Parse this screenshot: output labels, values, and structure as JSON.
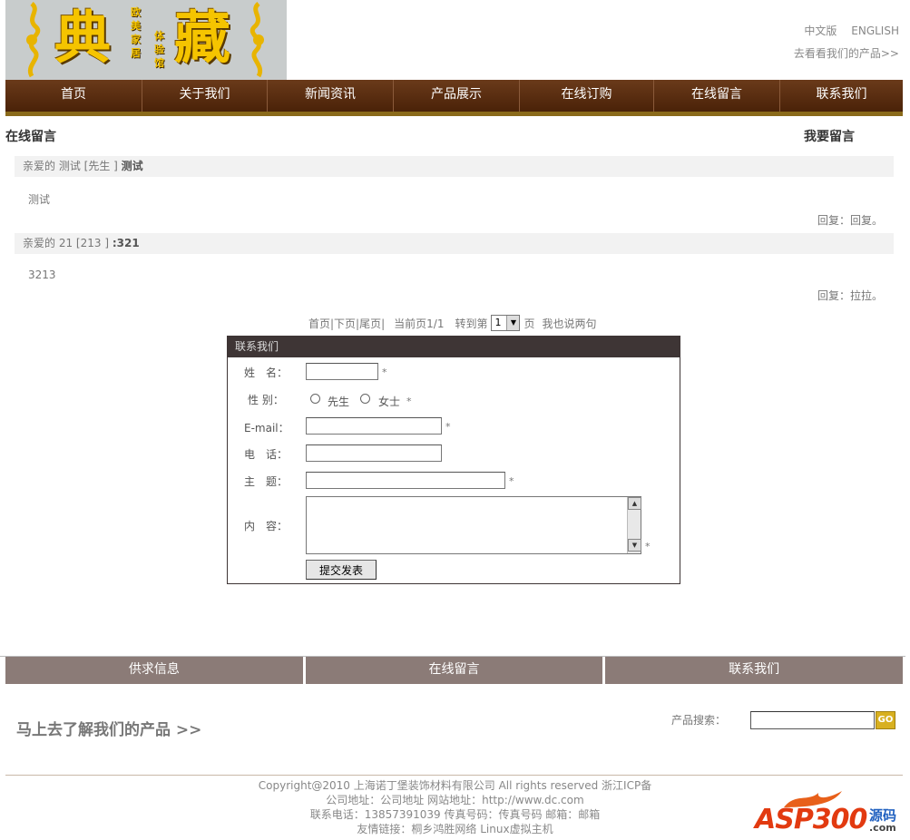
{
  "logo": {
    "char1": "典",
    "char2": "藏",
    "vert1": "欧美家居",
    "vert2": "体验馆"
  },
  "toplinks": {
    "lang_cn": "中文版",
    "lang_en": "ENGLISH",
    "products": "去看看我们的产品>>"
  },
  "nav": {
    "items": [
      "首页",
      "关于我们",
      "新闻资讯",
      "产品展示",
      "在线订购",
      "在线留言",
      "联系我们"
    ]
  },
  "page": {
    "section_title": "在线留言",
    "leave_message": "我要留言"
  },
  "messages": [
    {
      "prefix": "亲爱的",
      "name": "测试 [先生 ]",
      "subject": "测试",
      "body": "测试",
      "reply_label": "回复：",
      "reply": "回复。"
    },
    {
      "prefix": "亲爱的",
      "name": "21 [213 ]",
      "subject": ":321",
      "body": "3213",
      "reply_label": "回复：",
      "reply": "拉拉。"
    }
  ],
  "pager": {
    "links": "首页|下页|尾页|",
    "current": "当前页1/1",
    "goto": "转到第",
    "page_value": "1",
    "page_unit": "页",
    "say": "我也说两句"
  },
  "form": {
    "title": "联系我们",
    "name_label": "姓　名：",
    "gender_label": "性 别：",
    "male": "先生",
    "female": "女士",
    "email_label": "E-mail：",
    "phone_label": "电　话：",
    "subject_label": "主　题：",
    "content_label": "内　容：",
    "required": "*",
    "submit": "提交发表"
  },
  "footnav": {
    "items": [
      "供求信息",
      "在线留言",
      "联系我们"
    ]
  },
  "promo": {
    "text": "马上去了解我们的产品 >>",
    "search_label": "产品搜索：",
    "go": "GO"
  },
  "footer": {
    "line1": "Copyright@2010 上海诺丁堡装饰材料有限公司  All rights reserved  浙江ICP备",
    "line2": "公司地址：公司地址  网站地址：http://www.dc.com",
    "line3": "联系电话：13857391039 传真号码：传真号码  邮箱：邮箱",
    "line4": "友情链接：桐乡鸿胜网络  Linux虚拟主机"
  },
  "watermark": {
    "brand": "ASP300",
    "cn": "源码",
    "domain": ".com"
  }
}
